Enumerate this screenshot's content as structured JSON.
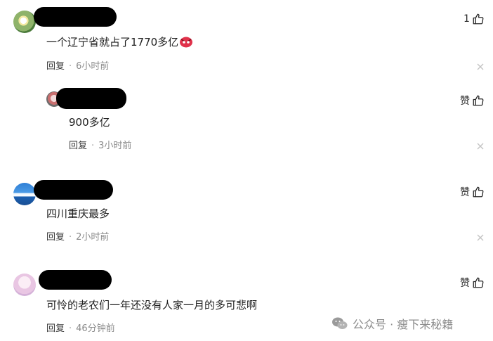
{
  "comments": [
    {
      "text": "一个辽宁省就占了1770多亿",
      "reply_label": "回复",
      "time": "6小时前",
      "like_label": "1"
    },
    {
      "text": "900多亿",
      "reply_label": "回复",
      "time": "3小时前",
      "like_label": "赞"
    },
    {
      "text": "四川重庆最多",
      "reply_label": "回复",
      "time": "2小时前",
      "like_label": "赞"
    },
    {
      "text": "可怜的老农们一年还没有人家一月的多可悲啊",
      "reply_label": "回复",
      "time": "46分钟前",
      "like_label": "赞"
    }
  ],
  "meta_separator": "·",
  "watermark": {
    "text": "公众号 · 瘦下来秘籍",
    "icon": "wechat-icon"
  },
  "icons": {
    "like": "thumbs-up-icon",
    "close": "close-icon",
    "emoji": "angry-face-icon"
  }
}
